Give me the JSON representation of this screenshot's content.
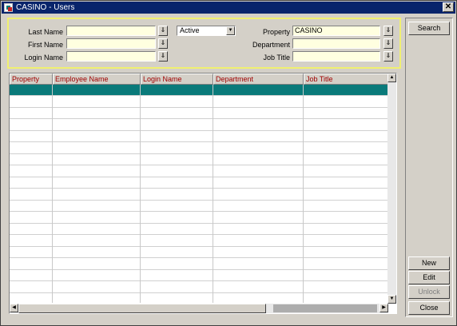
{
  "window": {
    "title": "CASINO - Users"
  },
  "filters": {
    "last_name": {
      "label": "Last Name",
      "value": ""
    },
    "first_name": {
      "label": "First Name",
      "value": ""
    },
    "login_name": {
      "label": "Login Name",
      "value": ""
    },
    "status": {
      "value": "Active"
    },
    "property": {
      "label": "Property",
      "value": "CASINO"
    },
    "department": {
      "label": "Department",
      "value": ""
    },
    "job_title": {
      "label": "Job Title",
      "value": ""
    }
  },
  "grid": {
    "columns": [
      "Property",
      "Employee Name",
      "Login Name",
      "Department",
      "Job Title"
    ],
    "rows": []
  },
  "buttons": {
    "search": "Search",
    "new": "New",
    "edit": "Edit",
    "unlock": "Unlock",
    "close": "Close"
  },
  "icons": {
    "app": "casino-app-icon",
    "close": "close-icon",
    "lov": "list-of-values-icon",
    "dropdown": "chevron-down-icon"
  }
}
